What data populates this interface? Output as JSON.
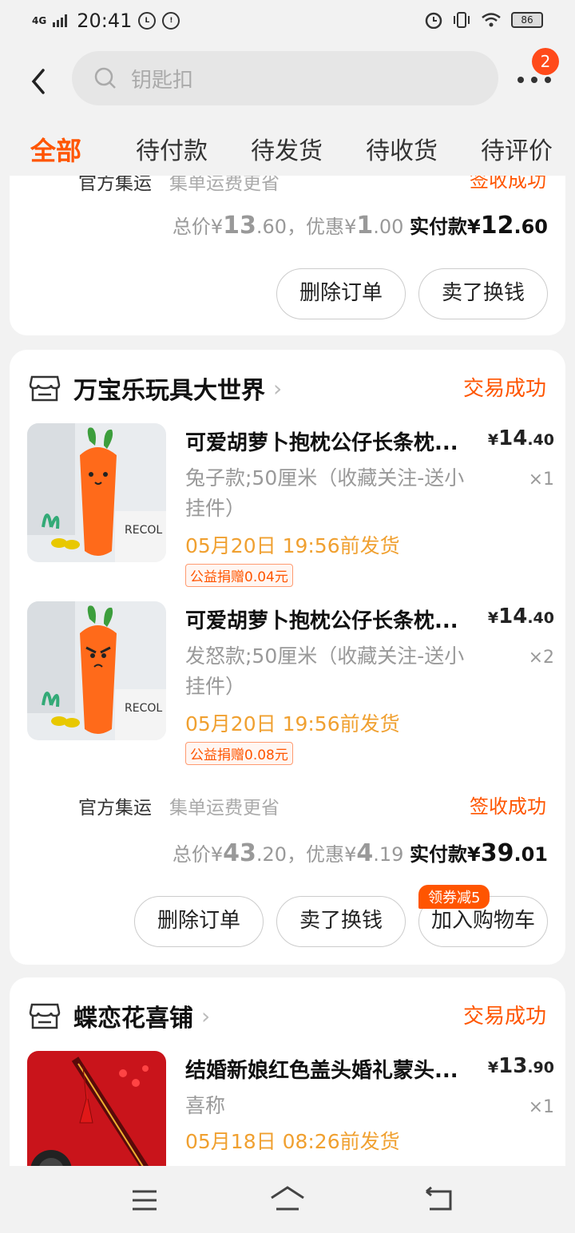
{
  "status_bar": {
    "network": "4G",
    "time": "20:41",
    "battery": "86"
  },
  "search": {
    "placeholder": "钥匙扣",
    "badge": "2"
  },
  "tabs": [
    "全部",
    "待付款",
    "待发货",
    "待收货",
    "待评价"
  ],
  "order0": {
    "ship_name": "官方集运",
    "ship_sub": "集单运费更省",
    "ship_status": "签收成功",
    "total_label": "总价",
    "total_int": "13",
    "total_dec": ".60",
    "discount_label": "，优惠",
    "discount_int": "1",
    "discount_dec": ".00",
    "paid_label": "实付款",
    "paid_int": "12",
    "paid_dec": ".60",
    "buttons": [
      "删除订单",
      "卖了换钱"
    ]
  },
  "order1": {
    "shop": "万宝乐玩具大世界",
    "status": "交易成功",
    "items": [
      {
        "title": "可爱胡萝卜抱枕公仔长条枕...",
        "spec": "兔子款;50厘米（收藏关注-送小挂件）",
        "ship": "05月20日 19:56前发货",
        "donate": "公益捐赠0.04元",
        "price_int": "14",
        "price_dec": ".40",
        "qty": "×1"
      },
      {
        "title": "可爱胡萝卜抱枕公仔长条枕...",
        "spec": "发怒款;50厘米（收藏关注-送小挂件）",
        "ship": "05月20日 19:56前发货",
        "donate": "公益捐赠0.08元",
        "price_int": "14",
        "price_dec": ".40",
        "qty": "×2"
      }
    ],
    "ship_name": "官方集运",
    "ship_sub": "集单运费更省",
    "ship_status": "签收成功",
    "total_label": "总价",
    "total_int": "43",
    "total_dec": ".20",
    "discount_label": "，优惠",
    "discount_int": "4",
    "discount_dec": ".19",
    "paid_label": "实付款",
    "paid_int": "39",
    "paid_dec": ".01",
    "buttons": [
      "删除订单",
      "卖了换钱",
      "加入购物车"
    ],
    "coupon_tag": "领券减5"
  },
  "order2": {
    "shop": "蝶恋花喜铺",
    "status": "交易成功",
    "items": [
      {
        "title": "结婚新娘红色盖头婚礼蒙头...",
        "spec": "喜称",
        "ship": "05月18日 08:26前发货",
        "price_int": "13",
        "price_dec": ".90",
        "qty": "×1"
      }
    ]
  },
  "currency": "¥"
}
